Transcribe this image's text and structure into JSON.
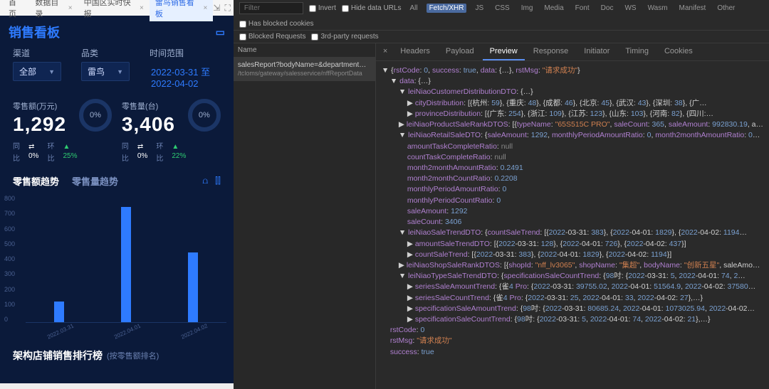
{
  "tabs": [
    {
      "label": "首页"
    },
    {
      "label": "数据目录"
    },
    {
      "label": "中国区实时快报"
    },
    {
      "label": "雷鸟销售看板",
      "active": true
    }
  ],
  "tabs_icons": {
    "collapse": "⇲",
    "fullscreen": "⛶"
  },
  "dashboard": {
    "title": "销售看板",
    "fs_icon": "▭"
  },
  "filters": {
    "channel": {
      "label": "渠道",
      "value": "全部"
    },
    "category": {
      "label": "品类",
      "value": "雷鸟"
    },
    "daterange": {
      "label": "时间范围",
      "value": "2022-03-31 至 2022-04-02"
    }
  },
  "metrics": {
    "amount": {
      "label": "零售额(万元)",
      "value": "1,292",
      "col1_lbl": "同",
      "col1_v": "⇄",
      "col2_lbl": "比",
      "col2_v": "0%",
      "col3_lbl": "环",
      "col3_v": "▲",
      "col4_lbl": "比",
      "col4_v": "25%",
      "donut": "0%"
    },
    "count": {
      "label": "零售量(台)",
      "value": "3,406",
      "col1_lbl": "同",
      "col1_v": "⇄",
      "col2_lbl": "比",
      "col2_v": "0%",
      "col3_lbl": "环",
      "col3_v": "▲",
      "col4_lbl": "比",
      "col4_v": "22%",
      "donut": "0%"
    }
  },
  "section_tabs": {
    "amount": "零售额趋势",
    "count": "零售量趋势",
    "icon_line": "⩍",
    "icon_bar": "⫿⫿"
  },
  "chart_data": {
    "type": "bar",
    "categories": [
      "2022.03.31",
      "2022.04.01",
      "2022.04.02"
    ],
    "values": [
      128,
      726,
      437
    ],
    "ylim": [
      0,
      800
    ],
    "yticks": [
      "800",
      "700",
      "600",
      "500",
      "400",
      "300",
      "200",
      "100",
      "0"
    ],
    "ylabel": "",
    "xlabel": ""
  },
  "rank": {
    "title": "架构店铺销售排行榜",
    "sub": "(按零售额排名)"
  },
  "devtools": {
    "filter_placeholder": "Filter",
    "row1": {
      "invert": "Invert",
      "hide": "Hide data URLs",
      "all": "All",
      "fetch": "Fetch/XHR",
      "js": "JS",
      "css": "CSS",
      "img": "Img",
      "media": "Media",
      "font": "Font",
      "doc": "Doc",
      "ws": "WS",
      "wasm": "Wasm",
      "manifest": "Manifest",
      "other": "Other",
      "blocked_cookies": "Has blocked cookies"
    },
    "row2": {
      "blocked_req": "Blocked Requests",
      "third": "3rd-party requests"
    },
    "name_col": "Name",
    "request": {
      "line1": "salesReport?bodyName=&departmentName…",
      "line2": "/tcloms/gateway/salesservice/nffReportData"
    },
    "detail_tabs": {
      "close": "×",
      "headers": "Headers",
      "payload": "Payload",
      "preview": "Preview",
      "response": "Response",
      "initiator": "Initiator",
      "timing": "Timing",
      "cookies": "Cookies"
    }
  },
  "response_json": {
    "root": "{rstCode: 0, success: true, data: {…}, rstMsg: \"请求成功\"}",
    "data_open": "data: {…}",
    "cust_dist": "leiNiaoCustomerDistributionDTO: {…}",
    "city_dist": "cityDistribution: [{杭州: 59}, {重庆: 48}, {成都: 46}, {北京: 45}, {武汉: 43}, {深圳: 38}, {广…",
    "prov_dist": "provinceDistribution: [{广东: 254}, {浙江: 109}, {江苏: 123}, {山东: 103}, {河南: 82}, {四川:…",
    "product_rank": "leiNiaoProductSaleRankDTOS: [{typeName: \"65S515C PRO\", saleCount: 365, saleAmount: 992830.19, a…",
    "retail_sale": "leiNiaoRetailSaleDTO: {saleAmount: 1292, monthlyPeriodAmountRatio: 0, month2monthAmountRatio: 0…",
    "amount_task": "amountTaskCompleteRatio: null",
    "count_task": "countTaskCompleteRatio: null",
    "m2m_amount": "month2monthAmountRatio: 0.2491",
    "m2m_count": "month2monthCountRatio: 0.2208",
    "mp_amount": "monthlyPeriodAmountRatio: 0",
    "mp_count": "monthlyPeriodCountRatio: 0",
    "sale_amount": "saleAmount: 1292",
    "sale_count": "saleCount: 3406",
    "sale_trend": "leiNiaoSaleTrendDTO: {countSaleTrend: [{2022-03-31: 383}, {2022-04-01: 1829}, {2022-04-02: 1194…",
    "amount_trend": "amountSaleTrendDTO: [{2022-03-31: 128}, {2022-04-01: 726}, {2022-04-02: 437}]",
    "count_trend": "countSaleTrend: [{2022-03-31: 383}, {2022-04-01: 1829}, {2022-04-02: 1194}]",
    "shop_rank": "leiNiaoShopSaleRankDTOS: [{shopId: \"nff_lv3065\", shopName: \"集超\", bodyName: \"创新五星\", saleAmo…",
    "type_trend": "leiNiaoTypeSaleTrendDTO: {specificationSaleCountTrend: {98吋: {2022-03-31: 5, 2022-04-01: 74, 2…",
    "series_amount": "seriesSaleAmountTrend: {雀4 Pro: {2022-03-31: 39755.02, 2022-04-01: 51564.9, 2022-04-02: 37580…",
    "series_count": "seriesSaleCountTrend: {雀4 Pro: {2022-03-31: 25, 2022-04-01: 33, 2022-04-02: 27},…}",
    "spec_amount": "specificationSaleAmountTrend: {98吋: {2022-03-31: 80685.24, 2022-04-01: 1073025.94, 2022-04-02…",
    "spec_count": "specificationSaleCountTrend: {98吋: {2022-03-31: 5, 2022-04-01: 74, 2022-04-02: 21},…}",
    "rst_code": "rstCode: 0",
    "rst_msg": "rstMsg: \"请求成功\"",
    "success": "success: true"
  }
}
